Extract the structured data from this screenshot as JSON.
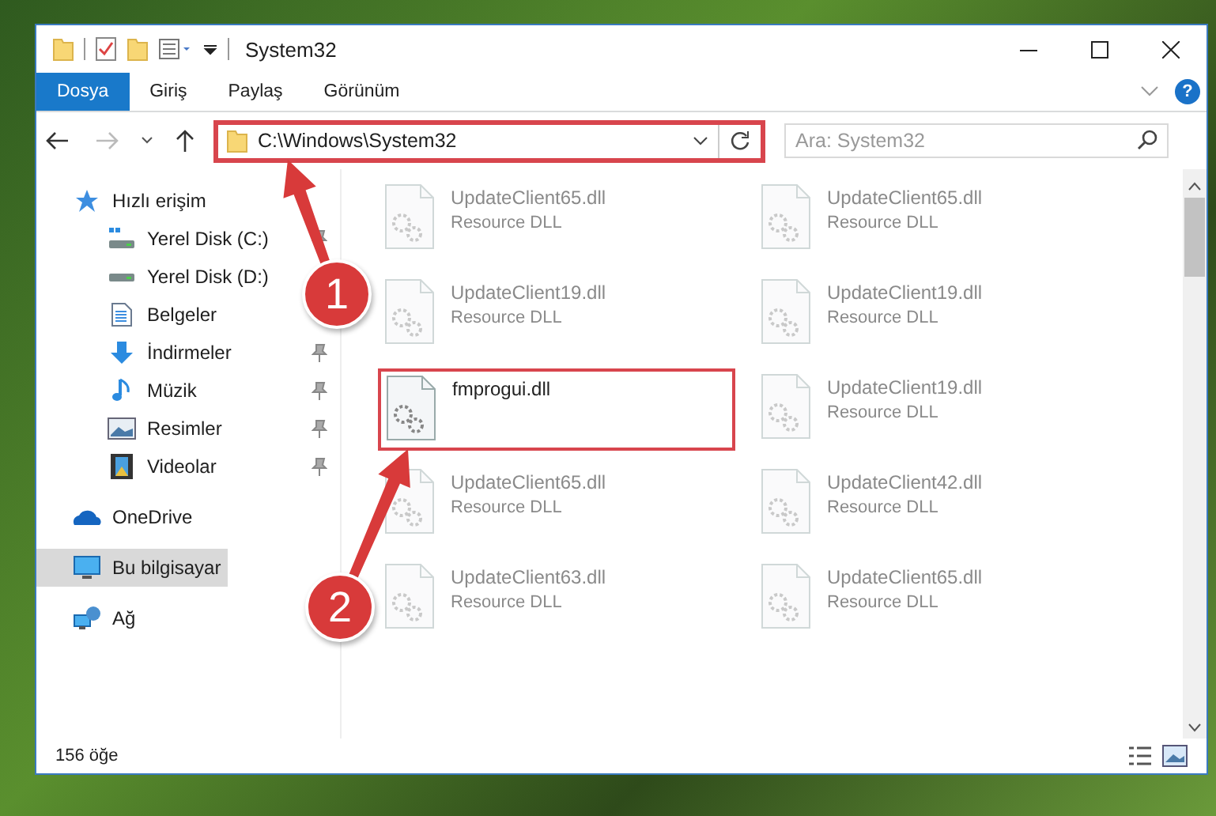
{
  "window": {
    "title": "System32",
    "help": "?"
  },
  "ribbon_tabs": [
    {
      "label": "Dosya",
      "selected": true
    },
    {
      "label": "Giriş",
      "selected": false
    },
    {
      "label": "Paylaş",
      "selected": false
    },
    {
      "label": "Görünüm",
      "selected": false
    }
  ],
  "address_bar": {
    "path": "C:\\Windows\\System32",
    "highlighted": true
  },
  "search": {
    "placeholder": "Ara: System32"
  },
  "navigation": [
    {
      "label": "Hızlı erişim",
      "kind": "quick",
      "selected": false,
      "children": [
        {
          "label": "Yerel Disk (C:)",
          "kind": "disk-c",
          "selected": false,
          "pinned": true
        },
        {
          "label": "Yerel Disk (D:)",
          "kind": "disk",
          "selected": false
        },
        {
          "label": "Belgeler",
          "kind": "documents",
          "selected": false
        },
        {
          "label": "İndirmeler",
          "kind": "downloads",
          "selected": false,
          "pinned": true
        },
        {
          "label": "Müzik",
          "kind": "music",
          "selected": false,
          "pinned": true
        },
        {
          "label": "Resimler",
          "kind": "pictures",
          "selected": false,
          "pinned": true
        },
        {
          "label": "Videolar",
          "kind": "videos",
          "selected": false,
          "pinned": true
        }
      ]
    },
    {
      "label": "OneDrive",
      "kind": "cloud",
      "selected": false
    },
    {
      "label": "Bu bilgisayar",
      "kind": "computer",
      "selected": true
    },
    {
      "label": "Ağ",
      "kind": "network",
      "selected": false
    }
  ],
  "files": [
    {
      "name": "UpdateClient65.dll",
      "type": "Resource DLL",
      "faded": true,
      "highlighted": false
    },
    {
      "name": "UpdateClient65.dll",
      "type": "Resource DLL",
      "faded": true,
      "highlighted": false
    },
    {
      "name": "UpdateClient19.dll",
      "type": "Resource DLL",
      "faded": true,
      "highlighted": false
    },
    {
      "name": "UpdateClient19.dll",
      "type": "Resource DLL",
      "faded": true,
      "highlighted": false
    },
    {
      "name": "fmprogui.dll",
      "faded": false,
      "highlighted": true
    },
    {
      "name": "UpdateClient19.dll",
      "type": "Resource DLL",
      "faded": true,
      "highlighted": false
    },
    {
      "name": "UpdateClient65.dll",
      "type": "Resource DLL",
      "faded": true,
      "highlighted": false
    },
    {
      "name": "UpdateClient42.dll",
      "type": "Resource DLL",
      "faded": true,
      "highlighted": false
    },
    {
      "name": "UpdateClient63.dll",
      "type": "Resource DLL",
      "faded": true,
      "highlighted": false
    },
    {
      "name": "UpdateClient65.dll",
      "type": "Resource DLL",
      "faded": true,
      "highlighted": false
    }
  ],
  "status_bar": {
    "item_count": "156 öğe"
  },
  "annotations": [
    {
      "label": "1"
    },
    {
      "label": "2"
    }
  ]
}
